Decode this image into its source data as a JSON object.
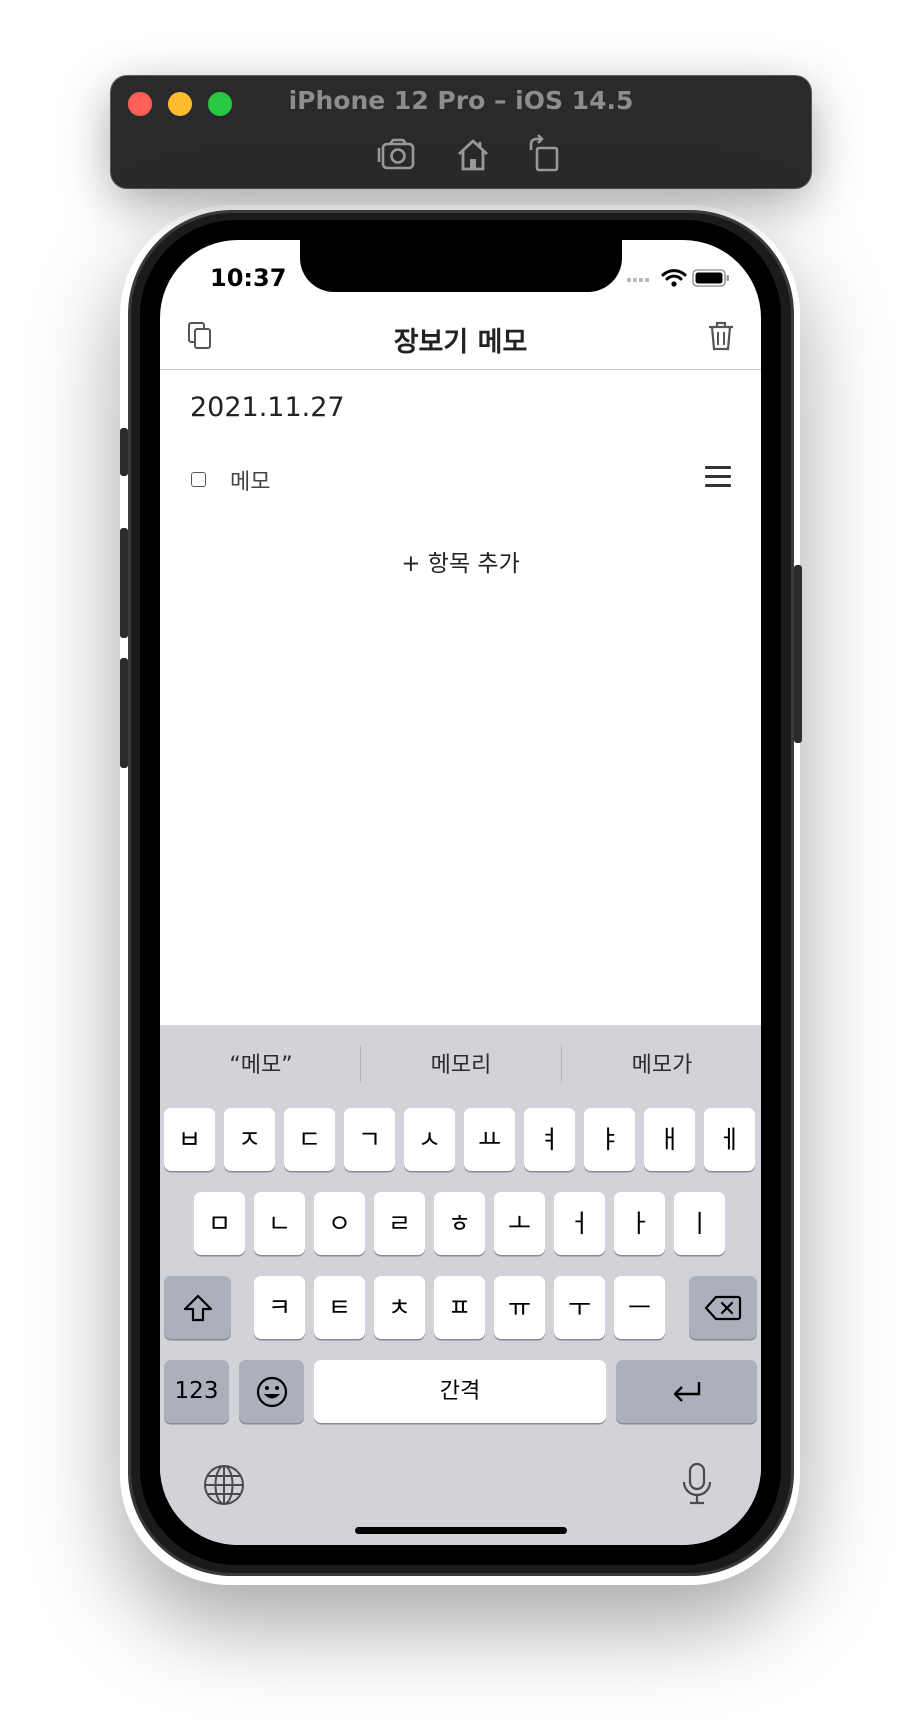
{
  "simulator": {
    "title": "iPhone 12 Pro – iOS 14.5",
    "tools": [
      "camera-icon",
      "home-icon",
      "rotate-icon"
    ]
  },
  "status_bar": {
    "time": "10:37"
  },
  "app": {
    "title": "장보기 메모",
    "date": "2021.11.27",
    "items": [
      {
        "text": "메모",
        "checked": false
      }
    ],
    "add_item_label": "+ 항목 추가"
  },
  "keyboard": {
    "suggestions": [
      "“메모”",
      "메모리",
      "메모가"
    ],
    "row1": [
      "ㅂ",
      "ㅈ",
      "ㄷ",
      "ㄱ",
      "ㅅ",
      "ㅛ",
      "ㅕ",
      "ㅑ",
      "ㅐ",
      "ㅔ"
    ],
    "row2": [
      "ㅁ",
      "ㄴ",
      "ㅇ",
      "ㄹ",
      "ㅎ",
      "ㅗ",
      "ㅓ",
      "ㅏ",
      "ㅣ"
    ],
    "row3": [
      "ㅋ",
      "ㅌ",
      "ㅊ",
      "ㅍ",
      "ㅠ",
      "ㅜ",
      "ㅡ"
    ],
    "numbers_label": "123",
    "space_label": "간격"
  }
}
